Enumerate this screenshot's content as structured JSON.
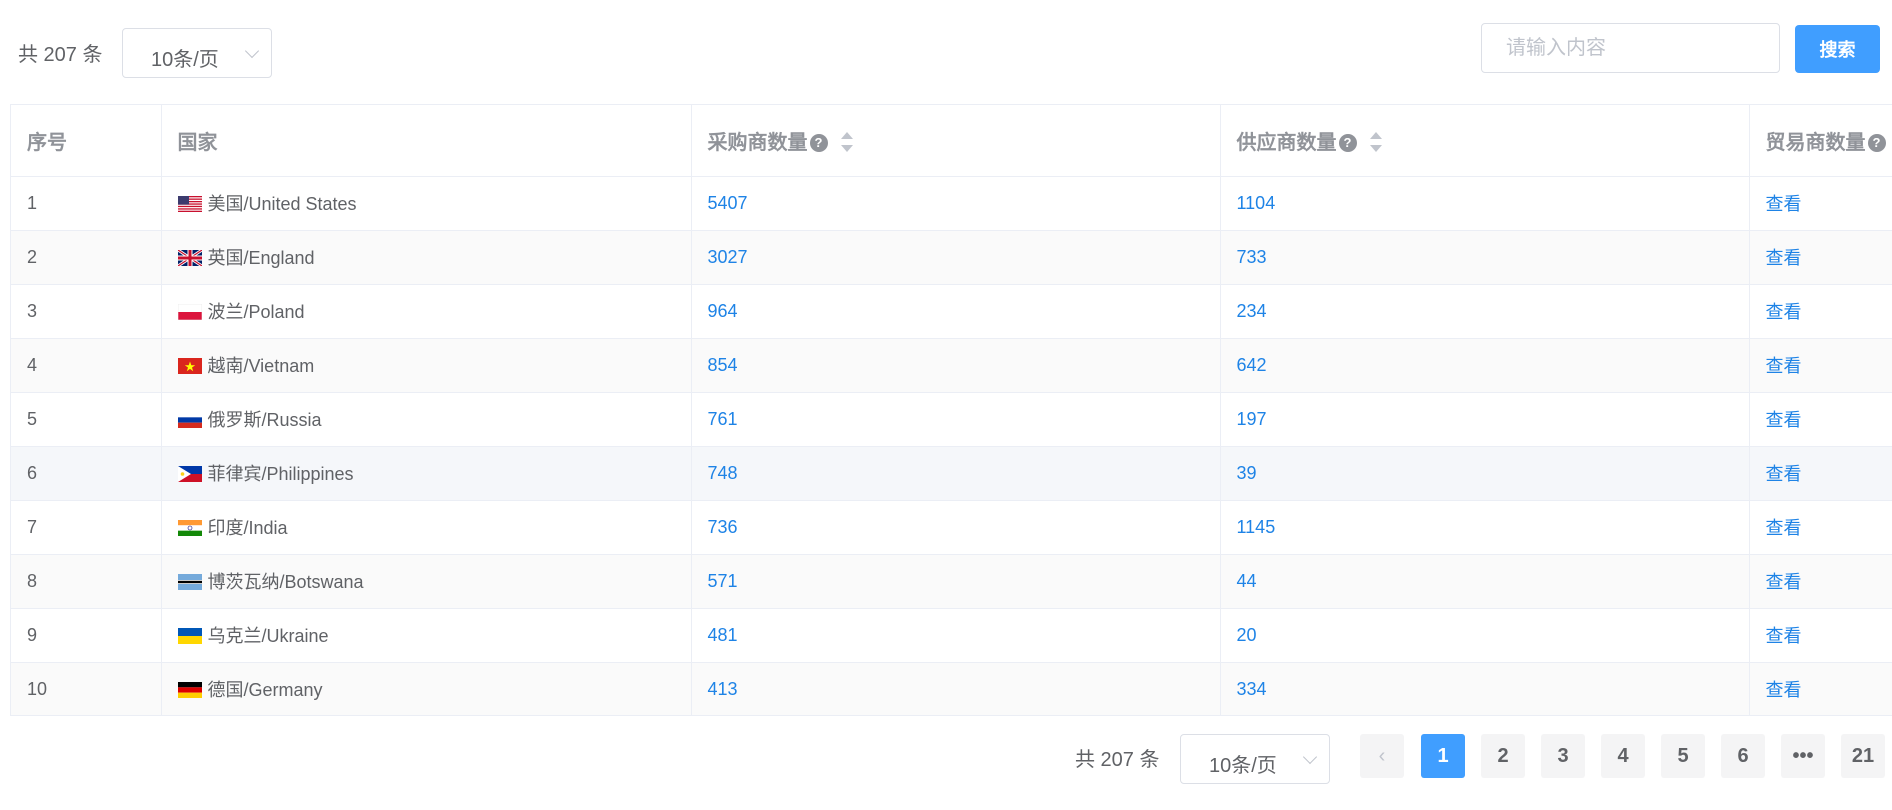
{
  "toolbar": {
    "total_label": "共 207 条",
    "page_size": "10条/页",
    "search_placeholder": "请输入内容",
    "search_button": "搜索"
  },
  "table": {
    "columns": {
      "index": "序号",
      "country": "国家",
      "buyers": "采购商数量",
      "suppliers": "供应商数量",
      "traders": "贸易商数量"
    },
    "rows": [
      {
        "index": "1",
        "flag": "us-flag-icon",
        "country": "美国/United States",
        "buyers": "5407",
        "suppliers": "1104",
        "traders": "查看"
      },
      {
        "index": "2",
        "flag": "uk-flag-icon",
        "country": "英国/England",
        "buyers": "3027",
        "suppliers": "733",
        "traders": "查看"
      },
      {
        "index": "3",
        "flag": "poland-flag-icon",
        "country": "波兰/Poland",
        "buyers": "964",
        "suppliers": "234",
        "traders": "查看"
      },
      {
        "index": "4",
        "flag": "vietnam-flag-icon",
        "country": "越南/Vietnam",
        "buyers": "854",
        "suppliers": "642",
        "traders": "查看"
      },
      {
        "index": "5",
        "flag": "russia-flag-icon",
        "country": "俄罗斯/Russia",
        "buyers": "761",
        "suppliers": "197",
        "traders": "查看"
      },
      {
        "index": "6",
        "flag": "philippines-flag-icon",
        "country": "菲律宾/Philippines",
        "buyers": "748",
        "suppliers": "39",
        "traders": "查看"
      },
      {
        "index": "7",
        "flag": "india-flag-icon",
        "country": "印度/India",
        "buyers": "736",
        "suppliers": "1145",
        "traders": "查看"
      },
      {
        "index": "8",
        "flag": "botswana-flag-icon",
        "country": "博茨瓦纳/Botswana",
        "buyers": "571",
        "suppliers": "44",
        "traders": "查看"
      },
      {
        "index": "9",
        "flag": "ukraine-flag-icon",
        "country": "乌克兰/Ukraine",
        "buyers": "481",
        "suppliers": "20",
        "traders": "查看"
      },
      {
        "index": "10",
        "flag": "germany-flag-icon",
        "country": "德国/Germany",
        "buyers": "413",
        "suppliers": "334",
        "traders": "查看"
      }
    ]
  },
  "pagination": {
    "total_label": "共 207 条",
    "page_size": "10条/页",
    "prev": "‹",
    "pages": [
      "1",
      "2",
      "3",
      "4",
      "5",
      "6",
      "•••",
      "21"
    ],
    "current": "1"
  },
  "colors": {
    "accent": "#409eff",
    "link": "#1e83e6"
  }
}
